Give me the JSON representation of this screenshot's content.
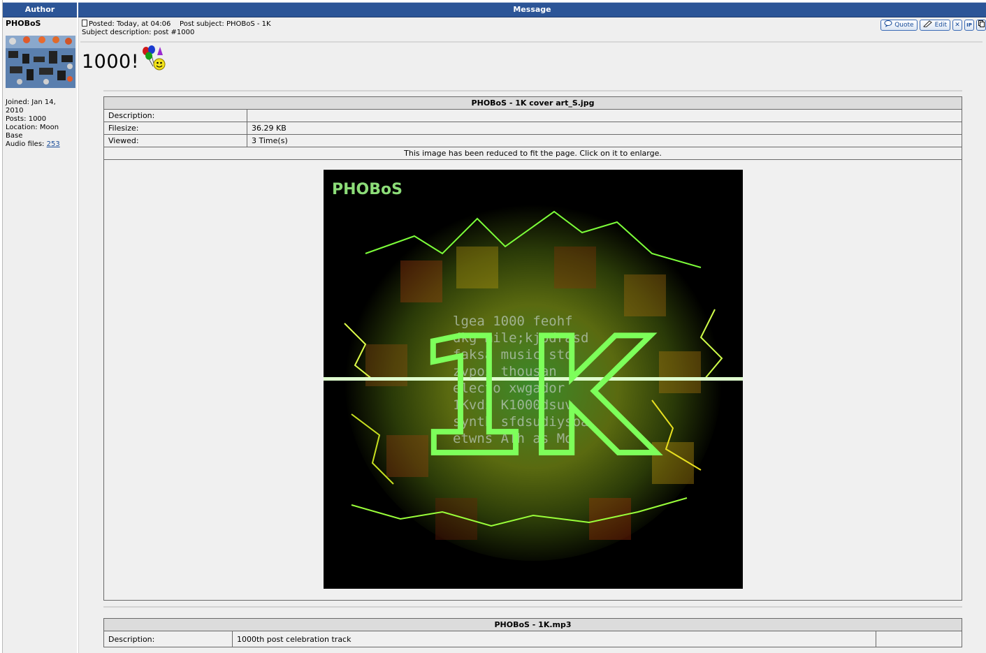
{
  "headers": {
    "author": "Author",
    "message": "Message"
  },
  "author": {
    "username": "PHOBoS",
    "joined_label": "Joined:",
    "joined_value": "Jan 14, 2010",
    "posts_label": "Posts:",
    "posts_value": "1000",
    "location_label": "Location:",
    "location_value": "Moon Base",
    "audio_label": "Audio files:",
    "audio_value": "253"
  },
  "post": {
    "posted_label": "Posted:",
    "posted_value": "Today, at 04:06",
    "subject_label": "Post subject:",
    "subject_value": "PHOBoS - 1K",
    "description_label": "Subject description:",
    "description_value": "post #1000",
    "body": "1000!",
    "actions": {
      "quote": "Quote",
      "edit": "Edit",
      "delete": "✕",
      "ip": "IP"
    }
  },
  "attachment1": {
    "filename": "PHOBoS - 1K cover art_S.jpg",
    "description_label": "Description:",
    "description_value": "",
    "filesize_label": "Filesize:",
    "filesize_value": "36.29 KB",
    "viewed_label": "Viewed:",
    "viewed_value": "3 Time(s)",
    "notice": "This image has been reduced to fit the page. Click on it to enlarge.",
    "image_title": "PHOBoS",
    "image_text_lines": [
      "lgea 1000 feohf",
      "dkg mile;kjpdrasd",
      "faksa music sto",
      "zvpos thousan",
      "electo xwgador",
      "1Kvds K1000dsuv",
      "synth sfdsudiysoa",
      "etwns ATh as Mo"
    ],
    "image_logo": "1K"
  },
  "attachment2": {
    "filename": "PHOBoS - 1K.mp3",
    "description_label": "Description:",
    "description_value": "1000th post celebration track"
  }
}
